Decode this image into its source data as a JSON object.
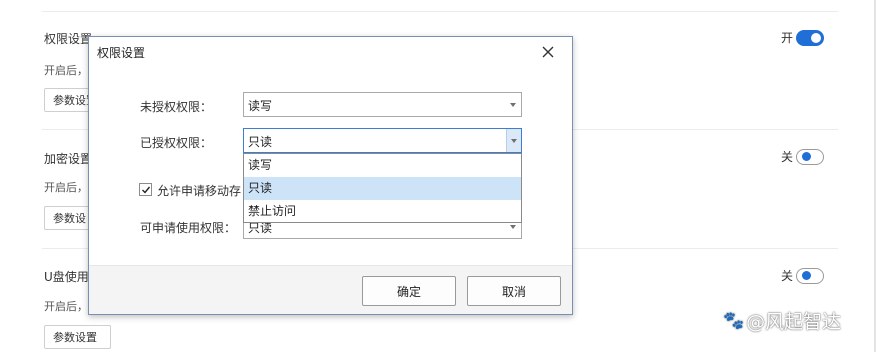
{
  "page": {
    "sections": [
      {
        "title": "权限设置",
        "desc": "开启后，",
        "button": "参数设置",
        "toggle_text": "开",
        "toggle_on": true
      },
      {
        "title": "加密设置",
        "desc": "开启后，",
        "button": "参数设",
        "toggle_text": "关",
        "toggle_on": false
      },
      {
        "title": "U盘使用",
        "desc": "开启后，",
        "button": "参数设置",
        "toggle_text": "关",
        "toggle_on": false
      }
    ]
  },
  "dialog": {
    "title": "权限设置",
    "close_icon": "close-icon",
    "fields": {
      "unauthorized": {
        "label": "未授权权限：",
        "value": "读写"
      },
      "authorized": {
        "label": "已授权权限：",
        "value": "只读"
      },
      "applicable": {
        "label": "可申请使用权限：",
        "value": "只读"
      }
    },
    "checkbox": {
      "label": "允许申请移动存储",
      "checked": true
    },
    "dropdown_options": [
      "读写",
      "只读",
      "禁止访问"
    ],
    "dropdown_selected": "只读",
    "ok_label": "确定",
    "cancel_label": "取消"
  },
  "watermark": {
    "text": "@风起智达"
  },
  "colors": {
    "accent": "#1f6fd6",
    "selection": "#cde3f8"
  }
}
